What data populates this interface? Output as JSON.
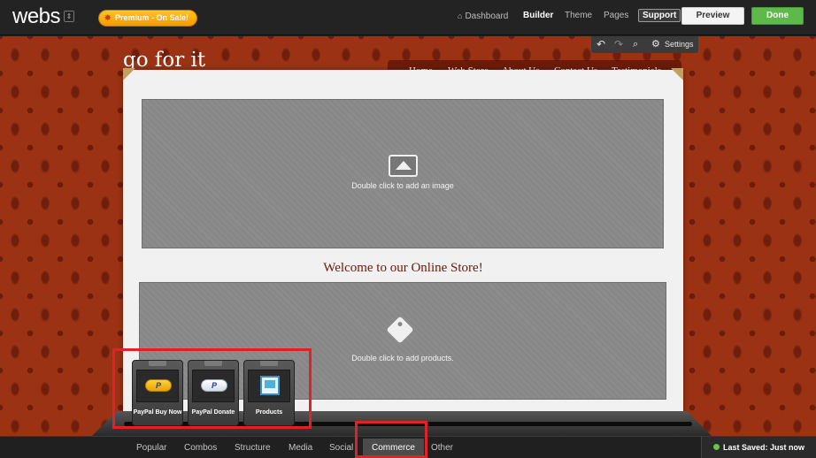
{
  "topbar": {
    "logo": "webs",
    "premium_label": "Premium - On Sale!",
    "nav": {
      "dashboard": "Dashboard",
      "builder": "Builder",
      "theme": "Theme",
      "pages": "Pages",
      "support": "Support"
    },
    "preview_label": "Preview",
    "done_label": "Done"
  },
  "edit_toolbar": {
    "settings_label": "Settings"
  },
  "site": {
    "title": "go for it",
    "nav": [
      "Home",
      "Web Store",
      "About Us",
      "Contact Us",
      "Testimonials"
    ]
  },
  "content": {
    "image_placeholder": "Double click to add an image",
    "welcome": "Welcome to our Online Store!",
    "products_placeholder": "Double click to add products."
  },
  "drawer": {
    "widgets": [
      {
        "label": "PayPal Buy Now",
        "icon": "paypal-gold-icon"
      },
      {
        "label": "PayPal Donate",
        "icon": "paypal-white-icon"
      },
      {
        "label": "Products",
        "icon": "products-icon"
      }
    ]
  },
  "bottom_tabs": {
    "items": [
      "Popular",
      "Combos",
      "Structure",
      "Media",
      "Social",
      "Commerce",
      "Other"
    ],
    "active": "Commerce"
  },
  "status": {
    "last_saved": "Last Saved: Just now"
  },
  "colors": {
    "accent_orange": "#f49a00",
    "done_green": "#5fb84a",
    "highlight_red": "#e0202a",
    "background_red": "#9b3214"
  }
}
